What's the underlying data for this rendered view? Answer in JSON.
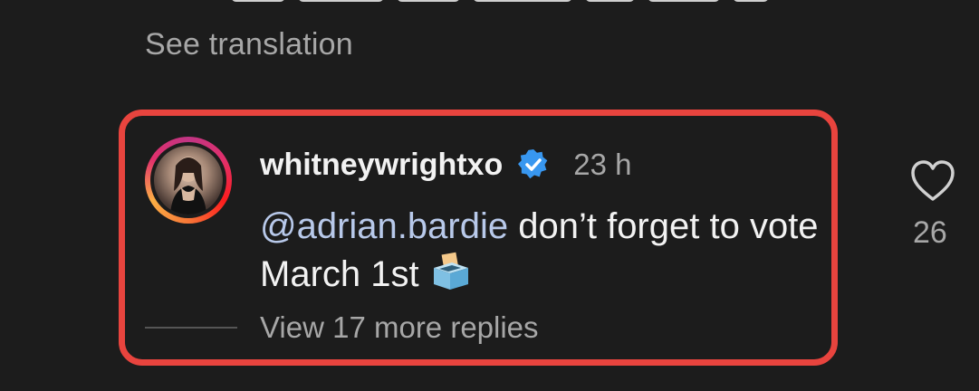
{
  "previous_comment": {
    "see_translation": "See translation"
  },
  "reply": {
    "username": "whitneywrightxo",
    "verified_icon": "verified-badge-icon",
    "time": "23 h",
    "mention": "@adrian.bardie",
    "text": " don’t forget to vote March 1st",
    "emoji_icon": "ballot-box-icon",
    "view_replies": "View 17 more replies",
    "like_icon": "heart-icon",
    "like_count": "26"
  },
  "colors": {
    "background": "#1c1c1c",
    "highlight_border": "#e8443e",
    "verified": "#3897f0",
    "secondary_text": "#a7a7a7"
  }
}
